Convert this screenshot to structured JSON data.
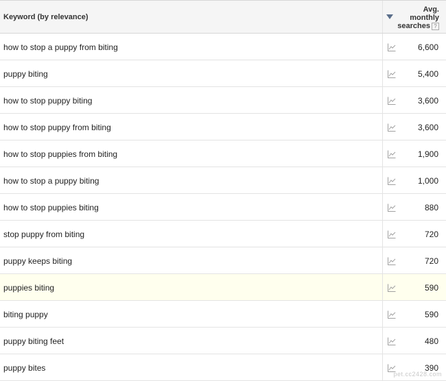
{
  "header": {
    "keyword_label": "Keyword (by relevance)",
    "avg_line1": "Avg.",
    "avg_line2": "monthly",
    "avg_line3": "searches",
    "help_glyph": "?"
  },
  "rows": [
    {
      "keyword": "how to stop a puppy from biting",
      "searches": "6,600",
      "highlight": false
    },
    {
      "keyword": "puppy biting",
      "searches": "5,400",
      "highlight": false
    },
    {
      "keyword": "how to stop puppy biting",
      "searches": "3,600",
      "highlight": false
    },
    {
      "keyword": "how to stop puppy from biting",
      "searches": "3,600",
      "highlight": false
    },
    {
      "keyword": "how to stop puppies from biting",
      "searches": "1,900",
      "highlight": false
    },
    {
      "keyword": "how to stop a puppy biting",
      "searches": "1,000",
      "highlight": false
    },
    {
      "keyword": "how to stop puppies biting",
      "searches": "880",
      "highlight": false
    },
    {
      "keyword": "stop puppy from biting",
      "searches": "720",
      "highlight": false
    },
    {
      "keyword": "puppy keeps biting",
      "searches": "720",
      "highlight": false
    },
    {
      "keyword": "puppies biting",
      "searches": "590",
      "highlight": true
    },
    {
      "keyword": "biting puppy",
      "searches": "590",
      "highlight": false
    },
    {
      "keyword": "puppy biting feet",
      "searches": "480",
      "highlight": false
    },
    {
      "keyword": "puppy bites",
      "searches": "390",
      "highlight": false
    }
  ],
  "watermark": "pet.cc2428.com",
  "colors": {
    "header_bg": "#f5f5f5",
    "highlight_row": "#ffffee",
    "sort_arrow": "#5a6e8a",
    "trend_icon": "#a0a0a0"
  },
  "icons": {
    "sort": "sort-descending-icon",
    "trend": "trend-chart-icon",
    "help": "help-icon"
  }
}
